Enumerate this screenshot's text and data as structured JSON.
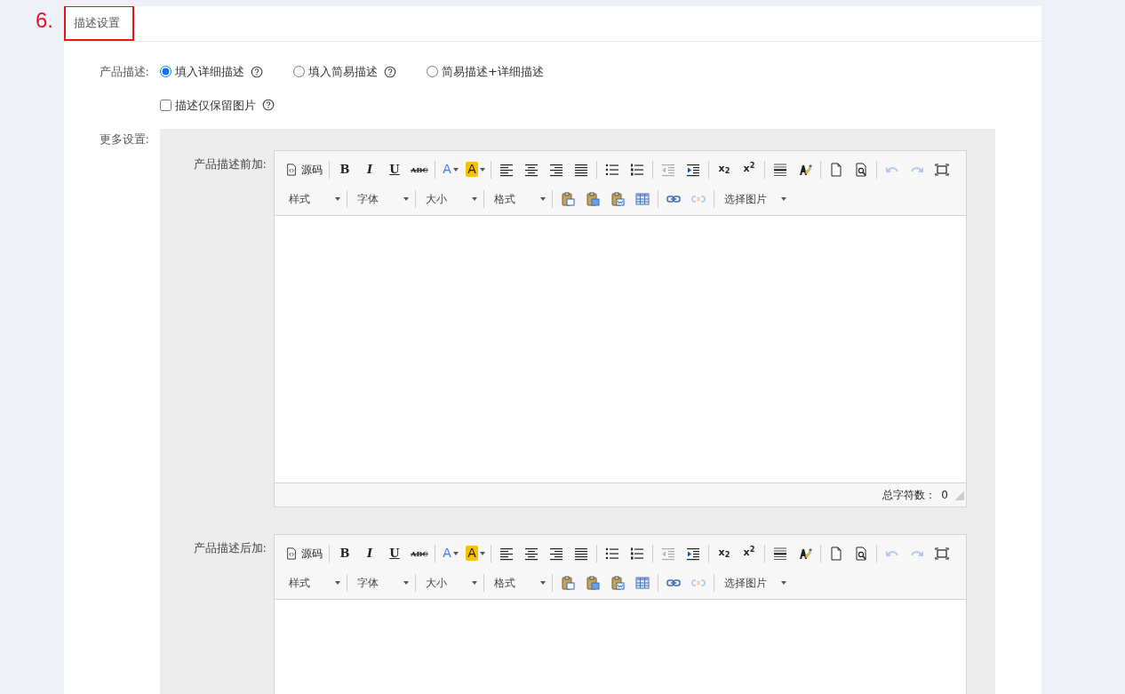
{
  "annotation": {
    "number": "6."
  },
  "section": {
    "title": "描述设置",
    "highlighted": true
  },
  "product_description": {
    "label": "产品描述:",
    "options": [
      {
        "label": "填入详细描述",
        "help": true,
        "selected": true
      },
      {
        "label": "填入简易描述",
        "help": true,
        "selected": false
      },
      {
        "label": "简易描述+详细描述",
        "help": false,
        "selected": false
      }
    ],
    "image_only": {
      "label": "描述仅保留图片",
      "help": true,
      "checked": false
    }
  },
  "more_settings": {
    "label": "更多设置:",
    "editors": [
      {
        "label": "产品描述前加:",
        "toolbar": [
          [
            {
              "kind": "source",
              "text": "源码",
              "disabled": false
            },
            {
              "kind": "sep"
            },
            {
              "kind": "bold",
              "text": "B",
              "disabled": false
            },
            {
              "kind": "italic",
              "text": "I",
              "disabled": false
            },
            {
              "kind": "underline",
              "text": "U",
              "disabled": false
            },
            {
              "kind": "strike",
              "text": "ABC",
              "disabled": false
            },
            {
              "kind": "sep"
            },
            {
              "kind": "forecolor",
              "text": "A",
              "disabled": false
            },
            {
              "kind": "backcolor",
              "text": "A",
              "disabled": false
            },
            {
              "kind": "sep"
            },
            {
              "kind": "align-left",
              "disabled": false
            },
            {
              "kind": "align-center",
              "disabled": false
            },
            {
              "kind": "align-right",
              "disabled": false
            },
            {
              "kind": "justify",
              "disabled": false
            },
            {
              "kind": "sep"
            },
            {
              "kind": "bullets",
              "disabled": false
            },
            {
              "kind": "numbers",
              "disabled": false
            },
            {
              "kind": "sep"
            },
            {
              "kind": "outdent",
              "disabled": true
            },
            {
              "kind": "indent",
              "disabled": false
            },
            {
              "kind": "sep"
            },
            {
              "kind": "subscript",
              "text": "x$_{2}$",
              "disabled": false
            },
            {
              "kind": "superscript",
              "text": "x$^{2}$",
              "disabled": false
            },
            {
              "kind": "sep"
            },
            {
              "kind": "rule",
              "disabled": false
            },
            {
              "kind": "painter",
              "disabled": false
            },
            {
              "kind": "sep"
            },
            {
              "kind": "page",
              "disabled": false
            },
            {
              "kind": "preview",
              "disabled": false
            },
            {
              "kind": "sep"
            },
            {
              "kind": "undo",
              "disabled": true
            },
            {
              "kind": "redo",
              "disabled": true
            },
            {
              "kind": "fullscreen",
              "disabled": false
            }
          ],
          [
            {
              "kind": "dropdown",
              "text": "样式",
              "disabled": false
            },
            {
              "kind": "sep"
            },
            {
              "kind": "dropdown",
              "text": "字体",
              "disabled": false
            },
            {
              "kind": "sep"
            },
            {
              "kind": "dropdown",
              "text": "大小",
              "disabled": false
            },
            {
              "kind": "sep"
            },
            {
              "kind": "dropdown",
              "text": "格式",
              "disabled": false
            },
            {
              "kind": "sep"
            },
            {
              "kind": "paste",
              "disabled": false
            },
            {
              "kind": "paste-text",
              "disabled": false
            },
            {
              "kind": "paste-word",
              "disabled": false
            },
            {
              "kind": "table",
              "disabled": false
            },
            {
              "kind": "sep"
            },
            {
              "kind": "link",
              "disabled": false
            },
            {
              "kind": "unlink",
              "disabled": true
            },
            {
              "kind": "sep"
            },
            {
              "kind": "dropdown",
              "text": "选择图片",
              "disabled": false
            }
          ]
        ],
        "status": {
          "label": "总字符数：",
          "count": "0"
        }
      },
      {
        "label": "产品描述后加:",
        "toolbar": [
          [
            {
              "kind": "source",
              "text": "源码",
              "disabled": false
            },
            {
              "kind": "sep"
            },
            {
              "kind": "bold",
              "text": "B",
              "disabled": false
            },
            {
              "kind": "italic",
              "text": "I",
              "disabled": false
            },
            {
              "kind": "underline",
              "text": "U",
              "disabled": false
            },
            {
              "kind": "strike",
              "text": "ABC",
              "disabled": false
            },
            {
              "kind": "sep"
            },
            {
              "kind": "forecolor",
              "text": "A",
              "disabled": false
            },
            {
              "kind": "backcolor",
              "text": "A",
              "disabled": false
            },
            {
              "kind": "sep"
            },
            {
              "kind": "align-left",
              "disabled": false
            },
            {
              "kind": "align-center",
              "disabled": false
            },
            {
              "kind": "align-right",
              "disabled": false
            },
            {
              "kind": "justify",
              "disabled": false
            },
            {
              "kind": "sep"
            },
            {
              "kind": "bullets",
              "disabled": false
            },
            {
              "kind": "numbers",
              "disabled": false
            },
            {
              "kind": "sep"
            },
            {
              "kind": "outdent",
              "disabled": true
            },
            {
              "kind": "indent",
              "disabled": false
            },
            {
              "kind": "sep"
            },
            {
              "kind": "subscript",
              "text": "x$_{2}$",
              "disabled": false
            },
            {
              "kind": "superscript",
              "text": "x$^{2}$",
              "disabled": false
            },
            {
              "kind": "sep"
            },
            {
              "kind": "rule",
              "disabled": false
            },
            {
              "kind": "painter",
              "disabled": false
            },
            {
              "kind": "sep"
            },
            {
              "kind": "page",
              "disabled": false
            },
            {
              "kind": "preview",
              "disabled": false
            },
            {
              "kind": "sep"
            },
            {
              "kind": "undo",
              "disabled": true
            },
            {
              "kind": "redo",
              "disabled": true
            },
            {
              "kind": "fullscreen",
              "disabled": false
            }
          ],
          [
            {
              "kind": "dropdown",
              "text": "样式",
              "disabled": false
            },
            {
              "kind": "sep"
            },
            {
              "kind": "dropdown",
              "text": "字体",
              "disabled": false
            },
            {
              "kind": "sep"
            },
            {
              "kind": "dropdown",
              "text": "大小",
              "disabled": false
            },
            {
              "kind": "sep"
            },
            {
              "kind": "dropdown",
              "text": "格式",
              "disabled": false
            },
            {
              "kind": "sep"
            },
            {
              "kind": "paste",
              "disabled": false
            },
            {
              "kind": "paste-text",
              "disabled": false
            },
            {
              "kind": "paste-word",
              "disabled": false
            },
            {
              "kind": "table",
              "disabled": false
            },
            {
              "kind": "sep"
            },
            {
              "kind": "link",
              "disabled": false
            },
            {
              "kind": "unlink",
              "disabled": true
            },
            {
              "kind": "sep"
            },
            {
              "kind": "dropdown",
              "text": "选择图片",
              "disabled": false
            }
          ]
        ]
      }
    ]
  }
}
